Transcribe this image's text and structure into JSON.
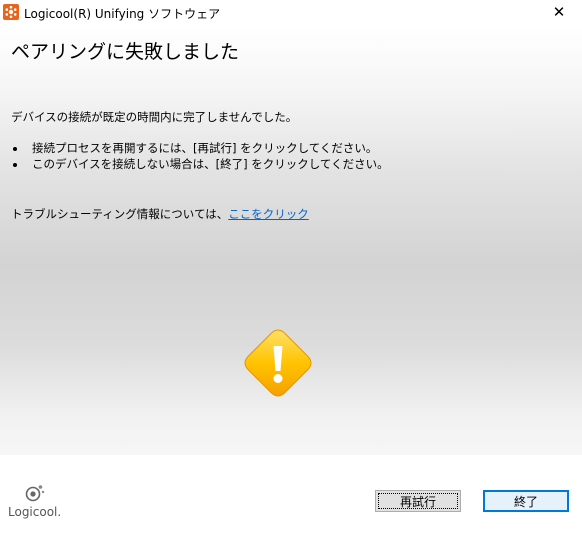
{
  "window": {
    "title": "Logicool(R) Unifying ソフトウェア",
    "close_glyph": "✕"
  },
  "heading": "ペアリングに失敗しました",
  "message": "デバイスの接続が既定の時間内に完了しませんでした。",
  "bullets": [
    "接続プロセスを再開するには、[再試行] をクリックしてください。",
    "このデバイスを接続しない場合は、[終了] をクリックしてください。"
  ],
  "troubleshooting": {
    "text": "トラブルシューティング情報については、",
    "link": "ここをクリック"
  },
  "icons": {
    "app": "logitech-unifying-icon",
    "warning": "warning-exclamation-icon",
    "logo": "logicool-logo"
  },
  "footer": {
    "logo_text": "Logicool.",
    "retry_label": "再試行",
    "finish_label": "終了"
  },
  "colors": {
    "app_icon": "#e8641c",
    "link": "#0066cc",
    "warning_fill": "#ffc400",
    "primary_border": "#0078d7"
  }
}
